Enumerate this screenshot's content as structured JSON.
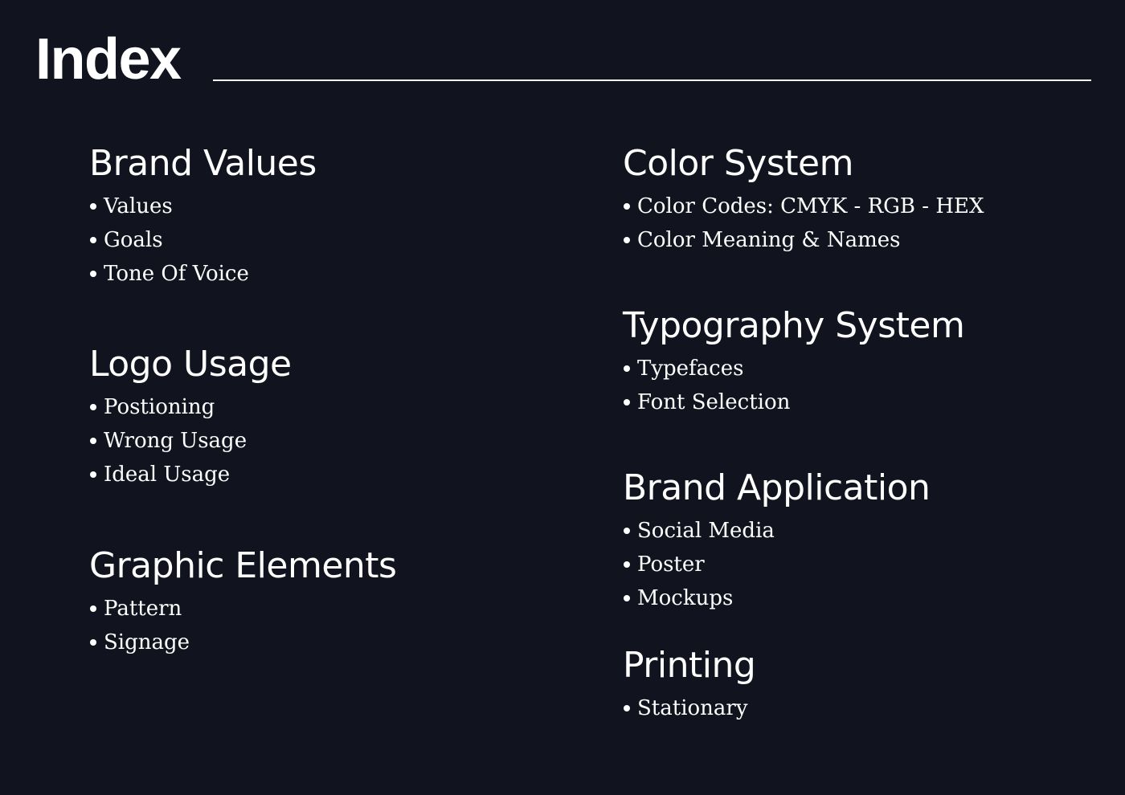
{
  "title": "Index",
  "theme": {
    "background": "#11141e",
    "text": "#ffffff"
  },
  "sections": [
    {
      "heading": "Brand Values",
      "items": [
        "Values",
        "Goals",
        "Tone Of Voice"
      ]
    },
    {
      "heading": "Logo Usage",
      "items": [
        "Postioning",
        "Wrong Usage",
        "Ideal Usage"
      ]
    },
    {
      "heading": "Graphic Elements",
      "items": [
        "Pattern",
        "Signage"
      ]
    },
    {
      "heading": "Color System",
      "items": [
        "Color Codes: CMYK - RGB - HEX",
        "Color Meaning & Names"
      ]
    },
    {
      "heading": "Typography System",
      "items": [
        "Typefaces",
        "Font Selection"
      ]
    },
    {
      "heading": "Brand Application",
      "items": [
        "Social Media",
        "Poster",
        "Mockups"
      ]
    },
    {
      "heading": "Printing",
      "items": [
        "Stationary"
      ]
    }
  ]
}
